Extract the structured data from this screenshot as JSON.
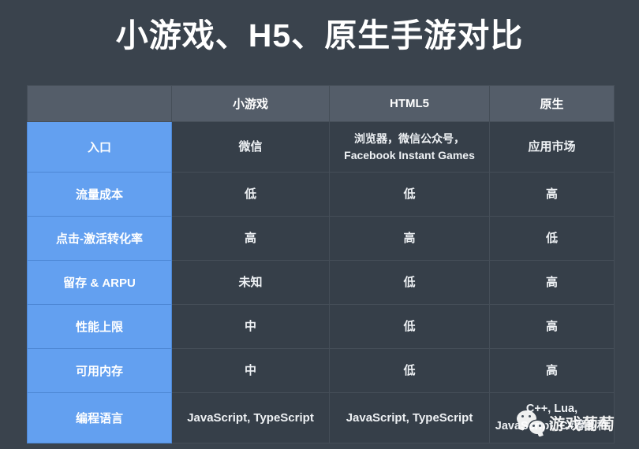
{
  "slide": {
    "title": "小游戏、H5、原生手游对比",
    "background_color": "#3a434d",
    "accent_color": "#63a0f0",
    "cell_color": "#363f49",
    "header_color": "#545d69"
  },
  "table": {
    "corner_label": "",
    "columns": [
      "",
      "小游戏",
      "HTML5",
      "原生"
    ],
    "rows": [
      {
        "label": "入口",
        "values": [
          "微信",
          "浏览器，微信公众号，Facebook Instant Games",
          "应用市场"
        ]
      },
      {
        "label": "流量成本",
        "values": [
          "低",
          "低",
          "高"
        ]
      },
      {
        "label": "点击-激活转化率",
        "values": [
          "高",
          "高",
          "低"
        ]
      },
      {
        "label": "留存 & ARPU",
        "values": [
          "未知",
          "低",
          "高"
        ]
      },
      {
        "label": "性能上限",
        "values": [
          "中",
          "低",
          "高"
        ]
      },
      {
        "label": "可用内存",
        "values": [
          "中",
          "低",
          "高"
        ]
      },
      {
        "label": "编程语言",
        "values": [
          "JavaScript, TypeScript",
          "JavaScript, TypeScript",
          "C++, Lua, JavaScript, C#等多种"
        ]
      }
    ]
  },
  "watermark": {
    "text": "游戏葡萄",
    "icon": "wechat-icon"
  }
}
